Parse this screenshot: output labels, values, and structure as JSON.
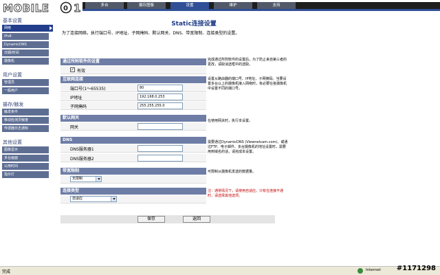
{
  "header": {
    "logo_text": "MOBILE01",
    "tabs": [
      "多台",
      "摄存图像",
      "设置",
      "维护",
      "支持"
    ],
    "active_tab": 2
  },
  "sidebar": {
    "sections": [
      {
        "title": "基本设置",
        "items": [
          "网络",
          "IPv6",
          "DynamicDNS",
          "日期/时间",
          "摄像机"
        ]
      },
      {
        "title": "用户设置",
        "items": [
          "管理员",
          "一般用户"
        ]
      },
      {
        "title": "摄存/触发",
        "items": [
          "触发条件",
          "移动检测灵敏度",
          "传感器日志通知"
        ]
      },
      {
        "title": "其他设置",
        "items": [
          "图像显示",
          "多台画面",
          "公用时间",
          "指示灯"
        ]
      }
    ],
    "active_item": "网络"
  },
  "main": {
    "title": "Static连接设置",
    "intro": "为了连接网络，执行端口号、IP地址、子网掩码、默认网关、DNS、带宽限制、连接类型的设置。",
    "sections": {
      "all_software": {
        "title": "通过所附软件的设置",
        "checkbox_label": "有效",
        "checked": true
      },
      "lan": {
        "title": "互联网连接",
        "port_label": "端口号(1～65535)",
        "port_value": "80",
        "ip_label": "IP地址",
        "ip_value": "192.168.0.253",
        "mask_label": "子网掩码",
        "mask_value": "255.255.255.0"
      },
      "gateway": {
        "title": "默认网关",
        "label": "网关",
        "value": ""
      },
      "dns": {
        "title": "DNS",
        "server1_label": "DNS服务器1",
        "server1_value": "",
        "server2_label": "DNS服务器2",
        "server2_value": ""
      },
      "bandwidth": {
        "title": "带宽限制",
        "selected": "无限制"
      },
      "conn_type": {
        "title": "连接类型",
        "selected": "自适应"
      }
    },
    "help": {
      "all_software": "完成通过所附软件的设置后，为了防止来自第三者的更改，请取消选框中的选取。",
      "lan": "设置从路由器的端口号、IP地址、子网掩码。当要设置多台以上的摄像机接入网络时，有必要在各摄像机中设置不同的端口号。",
      "gateway": "在使用网关时，执行本设置。",
      "dns": "需要通过DynamicDNS (Viewnetcam.com)、或通过FTP、电子邮件、多台摄像机的地址设置时，需要用到域名的话，请完成本设置。",
      "bandwidth": "可限制从摄像机发送的数据量。",
      "conn_type": "注：通常情况下，请使用自适应。只有在连接不通时，请选择其他选项。"
    },
    "buttons": {
      "save": "保存",
      "back": "返回"
    }
  },
  "statusbar": {
    "status": "完成",
    "zone": "Internet"
  },
  "watermark": "#1171298"
}
